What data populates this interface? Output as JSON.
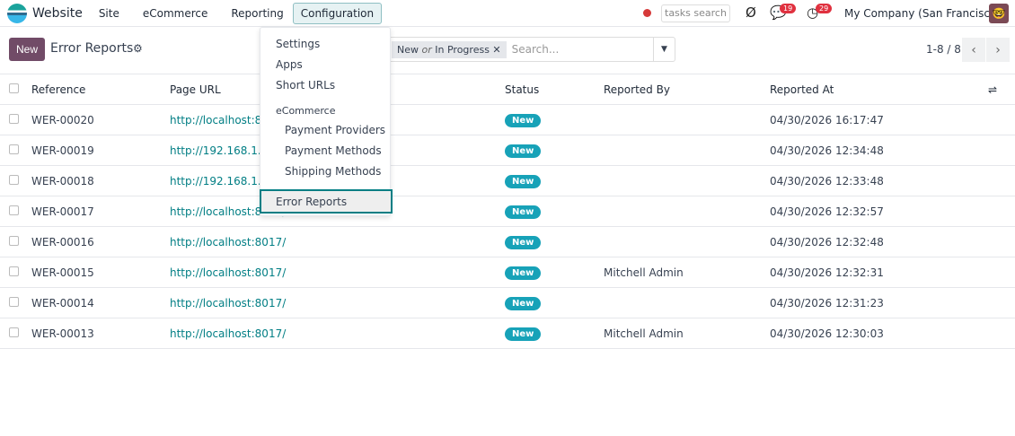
{
  "nav": {
    "brand": "Website",
    "menus": [
      "Site",
      "eCommerce",
      "Reporting",
      "Configuration"
    ],
    "tasks_search": "tasks search",
    "messages_count": "19",
    "activities_count": "29",
    "company": "My Company (San Francisco)"
  },
  "control": {
    "new_label": "New",
    "title": "Error Reports",
    "facet_a": "New",
    "facet_or": "or",
    "facet_b": "In Progress",
    "search_placeholder": "Search...",
    "pager": "1-8 / 8"
  },
  "dropdown": {
    "items": [
      "Settings",
      "Apps",
      "Short URLs"
    ],
    "section": "eCommerce",
    "sub_items": [
      "Payment Providers",
      "Payment Methods",
      "Shipping Methods"
    ],
    "selected": "Error Reports"
  },
  "table": {
    "headers": [
      "Reference",
      "Page URL",
      "Status",
      "Reported By",
      "Reported At"
    ],
    "rows": [
      [
        "WER-00020",
        "http://localhost:8017/",
        "New",
        "",
        "04/30/2026 16:17:47"
      ],
      [
        "WER-00019",
        "http://192.168.1.12",
        "New",
        "",
        "04/30/2026 12:34:48"
      ],
      [
        "WER-00018",
        "http://192.168.1.12",
        "New",
        "",
        "04/30/2026 12:33:48"
      ],
      [
        "WER-00017",
        "http://localhost:8017/",
        "New",
        "",
        "04/30/2026 12:32:57"
      ],
      [
        "WER-00016",
        "http://localhost:8017/",
        "New",
        "",
        "04/30/2026 12:32:48"
      ],
      [
        "WER-00015",
        "http://localhost:8017/",
        "New",
        "Mitchell Admin",
        "04/30/2026 12:32:31"
      ],
      [
        "WER-00014",
        "http://localhost:8017/",
        "New",
        "",
        "04/30/2026 12:31:23"
      ],
      [
        "WER-00013",
        "http://localhost:8017/",
        "New",
        "Mitchell Admin",
        "04/30/2026 12:30:03"
      ]
    ]
  }
}
